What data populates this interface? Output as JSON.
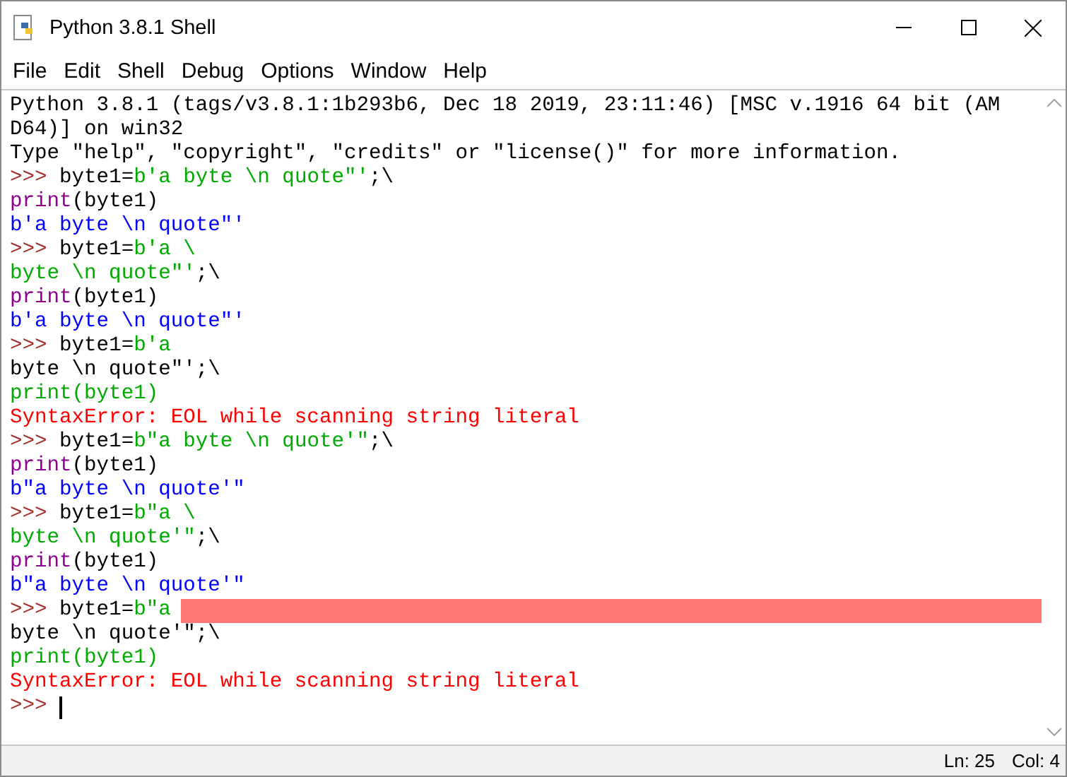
{
  "window": {
    "title": "Python 3.8.1 Shell"
  },
  "menu": [
    "File",
    "Edit",
    "Shell",
    "Debug",
    "Options",
    "Window",
    "Help"
  ],
  "lines": [
    {
      "segments": [
        {
          "kind": "stdout",
          "text": "Python 3.8.1 (tags/v3.8.1:1b293b6, Dec 18 2019, 23:11:46) [MSC v.1916 64 bit (AM"
        }
      ]
    },
    {
      "segments": [
        {
          "kind": "stdout",
          "text": "D64)] on win32"
        }
      ]
    },
    {
      "segments": [
        {
          "kind": "stdout",
          "text": "Type \"help\", \"copyright\", \"credits\" or \"license()\" for more information."
        }
      ]
    },
    {
      "segments": [
        {
          "kind": "prompt",
          "text": ">>>"
        },
        {
          "kind": "code",
          "text": " byte1="
        },
        {
          "kind": "string",
          "text": "b'a byte \\n quote\"'"
        },
        {
          "kind": "code",
          "text": ";\\"
        }
      ]
    },
    {
      "segments": [
        {
          "kind": "builtin",
          "text": "print"
        },
        {
          "kind": "code",
          "text": "(byte1)"
        }
      ]
    },
    {
      "segments": [
        {
          "kind": "output",
          "text": "b'a byte \\n quote\"'"
        }
      ]
    },
    {
      "segments": [
        {
          "kind": "prompt",
          "text": ">>>"
        },
        {
          "kind": "code",
          "text": " byte1="
        },
        {
          "kind": "string",
          "text": "b'a \\"
        }
      ]
    },
    {
      "segments": [
        {
          "kind": "string",
          "text": "byte \\n quote\"'"
        },
        {
          "kind": "code",
          "text": ";\\"
        }
      ]
    },
    {
      "segments": [
        {
          "kind": "builtin",
          "text": "print"
        },
        {
          "kind": "code",
          "text": "(byte1)"
        }
      ]
    },
    {
      "segments": [
        {
          "kind": "output",
          "text": "b'a byte \\n quote\"'"
        }
      ]
    },
    {
      "segments": [
        {
          "kind": "prompt",
          "text": ">>>"
        },
        {
          "kind": "code",
          "text": " byte1="
        },
        {
          "kind": "string",
          "text": "b'a"
        }
      ]
    },
    {
      "segments": [
        {
          "kind": "code",
          "text": "byte \\n quote\"';\\"
        }
      ]
    },
    {
      "segments": [
        {
          "kind": "string",
          "text": "print(byte1)"
        }
      ]
    },
    {
      "segments": [
        {
          "kind": "error",
          "text": "SyntaxError: EOL while scanning string literal"
        }
      ]
    },
    {
      "segments": [
        {
          "kind": "prompt",
          "text": ">>>"
        },
        {
          "kind": "code",
          "text": " byte1="
        },
        {
          "kind": "string",
          "text": "b\"a byte \\n quote'\""
        },
        {
          "kind": "code",
          "text": ";\\"
        }
      ]
    },
    {
      "segments": [
        {
          "kind": "builtin",
          "text": "print"
        },
        {
          "kind": "code",
          "text": "(byte1)"
        }
      ]
    },
    {
      "segments": [
        {
          "kind": "output",
          "text": "b\"a byte \\n quote'\""
        }
      ]
    },
    {
      "segments": [
        {
          "kind": "prompt",
          "text": ">>>"
        },
        {
          "kind": "code",
          "text": " byte1="
        },
        {
          "kind": "string",
          "text": "b\"a \\"
        }
      ]
    },
    {
      "segments": [
        {
          "kind": "string",
          "text": "byte \\n quote'\""
        },
        {
          "kind": "code",
          "text": ";\\"
        }
      ]
    },
    {
      "segments": [
        {
          "kind": "builtin",
          "text": "print"
        },
        {
          "kind": "code",
          "text": "(byte1)"
        }
      ]
    },
    {
      "segments": [
        {
          "kind": "output",
          "text": "b\"a byte \\n quote'\""
        }
      ]
    },
    {
      "error_mark": true,
      "segments": [
        {
          "kind": "prompt",
          "text": ">>>"
        },
        {
          "kind": "code",
          "text": " byte1="
        },
        {
          "kind": "string",
          "text": "b\"a"
        }
      ]
    },
    {
      "segments": [
        {
          "kind": "code",
          "text": "byte \\n quote'\";\\"
        }
      ]
    },
    {
      "segments": [
        {
          "kind": "string",
          "text": "print(byte1)"
        }
      ]
    },
    {
      "segments": [
        {
          "kind": "error",
          "text": "SyntaxError: EOL while scanning string literal"
        }
      ]
    },
    {
      "cursor": true,
      "segments": [
        {
          "kind": "prompt",
          "text": ">>>"
        }
      ]
    }
  ],
  "status_bar": {
    "line": "Ln: 25",
    "column": "Col: 4"
  }
}
